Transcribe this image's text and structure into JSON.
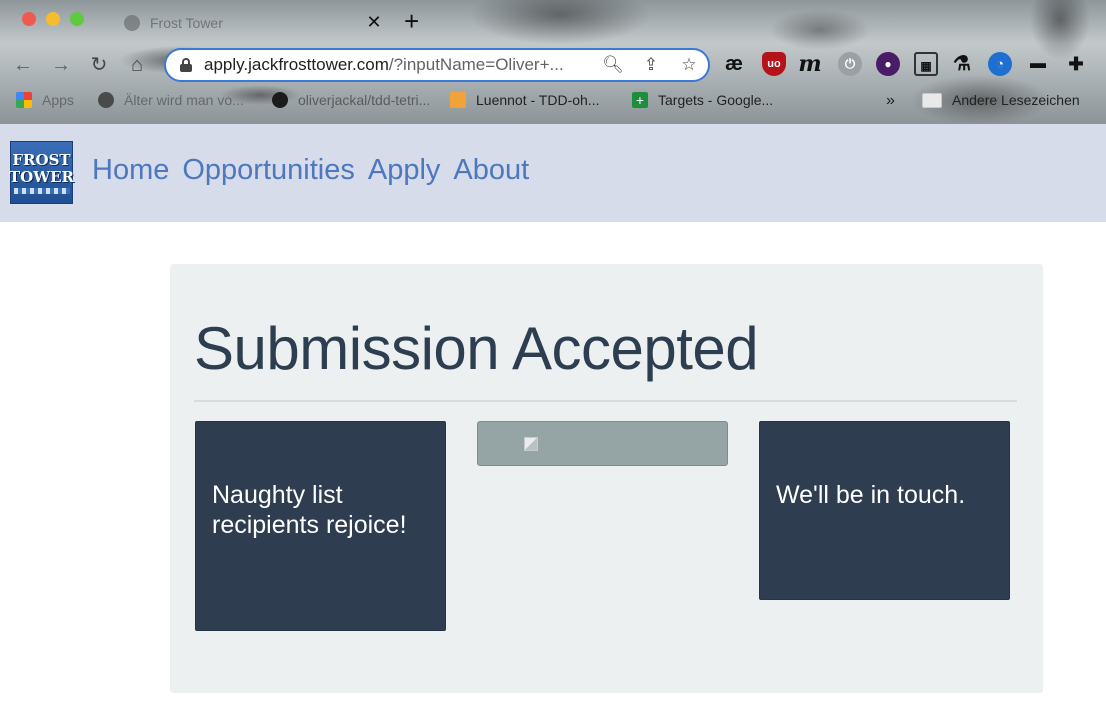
{
  "browser": {
    "tab": {
      "title": "Frost Tower"
    },
    "address_bar": {
      "host": "apply.jackfrosttower.com",
      "path": "/?inputName=Oliver+..."
    },
    "bookmarks": [
      {
        "label": "Apps"
      },
      {
        "label": "Älter wird man vo..."
      },
      {
        "label": "oliverjackal/tdd-tetri..."
      },
      {
        "label": "Luennot - TDD-oh..."
      },
      {
        "label": "Targets - Google..."
      }
    ],
    "bookmarks_more": "»",
    "other_bookmarks": "Andere Lesezeichen"
  },
  "site": {
    "logo_lines": [
      "FROST",
      "TOWER"
    ],
    "nav": [
      {
        "label": "Home"
      },
      {
        "label": "Opportunities"
      },
      {
        "label": "Apply"
      },
      {
        "label": "About"
      }
    ],
    "nav_color": "#4d77be"
  },
  "main": {
    "title": "Submission Accepted",
    "left_box_text": "Naughty list recipients rejoice!",
    "right_box_text": "We'll be in touch.",
    "box_color": "#2e3e50",
    "middle_box_color": "#95a5a6"
  }
}
